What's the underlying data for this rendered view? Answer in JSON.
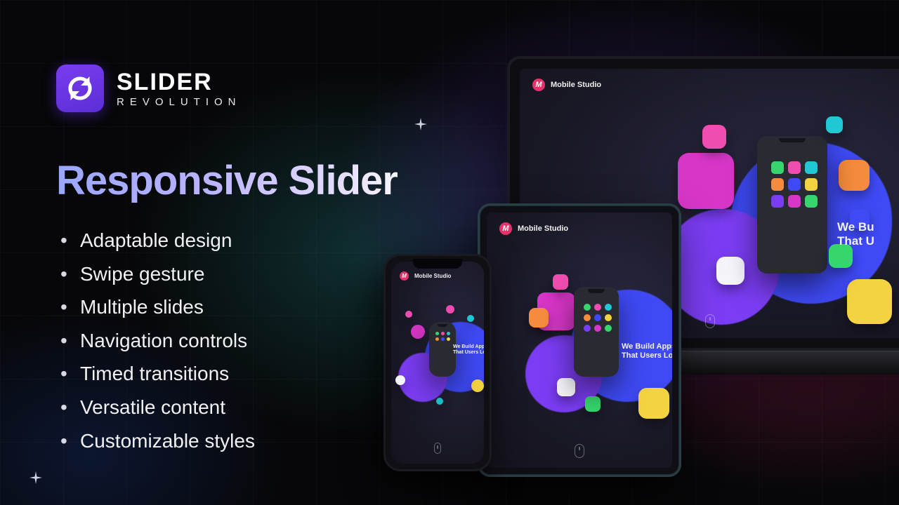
{
  "brand": {
    "top": "SLIDER",
    "bottom": "REVOLUTION"
  },
  "headline": "Responsive Slider",
  "features": [
    "Adaptable design",
    "Swipe gesture",
    "Multiple slides",
    "Navigation controls",
    "Timed transitions",
    "Versatile content",
    "Customizable styles"
  ],
  "device_brand": {
    "mark": "M",
    "name": "Mobile Studio"
  },
  "device_tagline": {
    "line1": "We Build Apps",
    "line2": "That Users Love"
  },
  "device_tagline_clipped": {
    "line1": "We Bu",
    "line2": "That U"
  },
  "palette": {
    "pink": "#ef4daf",
    "mag": "#d836c8",
    "purple": "#7b3df3",
    "blue": "#3f4af5",
    "cyan": "#1fc8d4",
    "green": "#35d66b",
    "yellow": "#f4d340",
    "orange": "#f58b3c",
    "white": "#f5f5fa"
  }
}
